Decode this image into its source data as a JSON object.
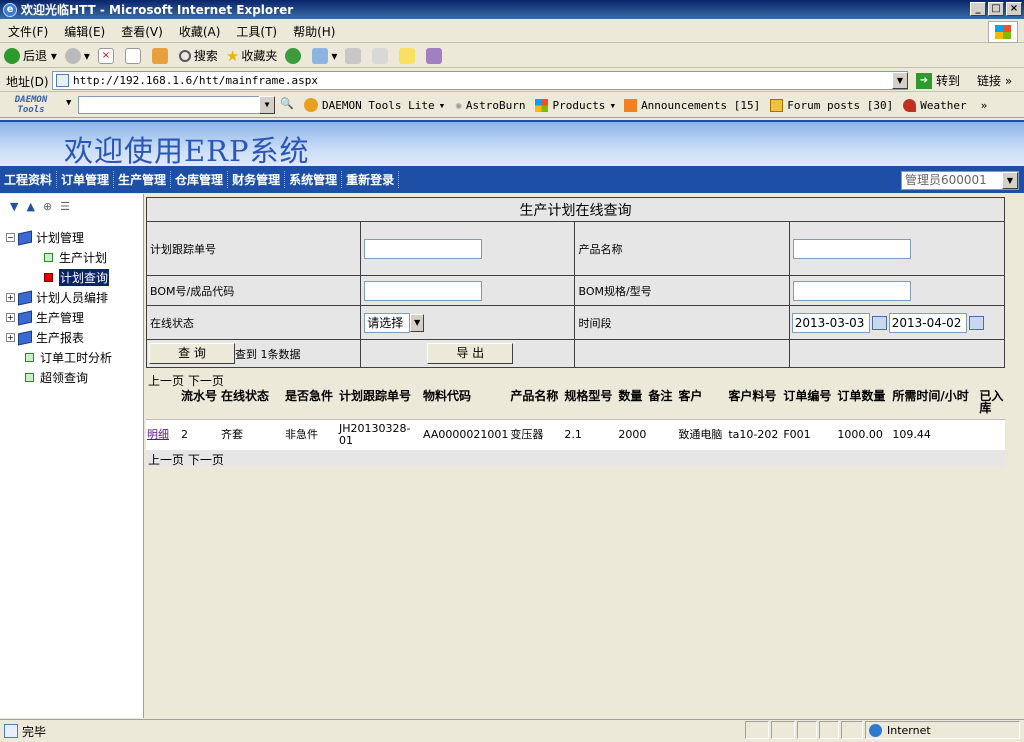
{
  "window": {
    "title": "欢迎光临HTT - Microsoft Internet Explorer"
  },
  "menu": [
    "文件(F)",
    "编辑(E)",
    "查看(V)",
    "收藏(A)",
    "工具(T)",
    "帮助(H)"
  ],
  "toolbar": {
    "back": "后退",
    "search": "搜索",
    "favorites": "收藏夹"
  },
  "address": {
    "label": "地址(D)",
    "url": "http://192.168.1.6/htt/mainframe.aspx",
    "go": "转到",
    "links": "链接"
  },
  "daemon": {
    "logo1": "DAEMON",
    "logo2": "Tools",
    "daemon_lite": "DAEMON Tools Lite",
    "astroburn": "AstroBurn",
    "products": "Products",
    "announcements": "Announcements [15]",
    "forum": "Forum posts [30]",
    "weather": "Weather"
  },
  "app": {
    "title": "欢迎使用ERP系统",
    "user": "管理员600001"
  },
  "nav": [
    "工程资料",
    "订单管理",
    "生产管理",
    "仓库管理",
    "财务管理",
    "系统管理",
    "重新登录"
  ],
  "tree": {
    "plan_mgmt": "计划管理",
    "prod_plan": "生产计划",
    "plan_query": "计划查询",
    "staff_plan": "计划人员编排",
    "prod_mgmt": "生产管理",
    "prod_report": "生产报表",
    "order_hours": "订单工时分析",
    "over_query": "超领查询"
  },
  "form": {
    "title": "生产计划在线查询",
    "plan_no": "计划跟踪单号",
    "product_name": "产品名称",
    "bom_code": "BOM号/成品代码",
    "bom_spec": "BOM规格/型号",
    "status": "在线状态",
    "status_value": "请选择",
    "period": "时间段",
    "date_from": "2013-03-03",
    "date_to": "2013-04-02",
    "query_btn": "查 询",
    "found": "查到 1条数据",
    "export_btn": "导 出"
  },
  "pager": {
    "prev": "上一页",
    "next": "下一页"
  },
  "results": {
    "headers": [
      "",
      "流水号",
      "在线状态",
      "是否急件",
      "计划跟踪单号",
      "物料代码",
      "产品名称",
      "规格型号",
      "数量",
      "备注",
      "客户",
      "客户料号",
      "订单编号",
      "订单数量",
      "所需时间/小时",
      "已入库"
    ],
    "rows": [
      [
        "明细",
        "2",
        "齐套",
        "非急件",
        "JH20130328-01",
        "AA0000021001",
        "变压器",
        "2.1",
        "2000",
        "",
        "致通电脑",
        "ta10-202",
        "F001",
        "1000.00",
        "109.44",
        ""
      ]
    ]
  },
  "status": {
    "text": "完毕",
    "zone": "Internet"
  }
}
